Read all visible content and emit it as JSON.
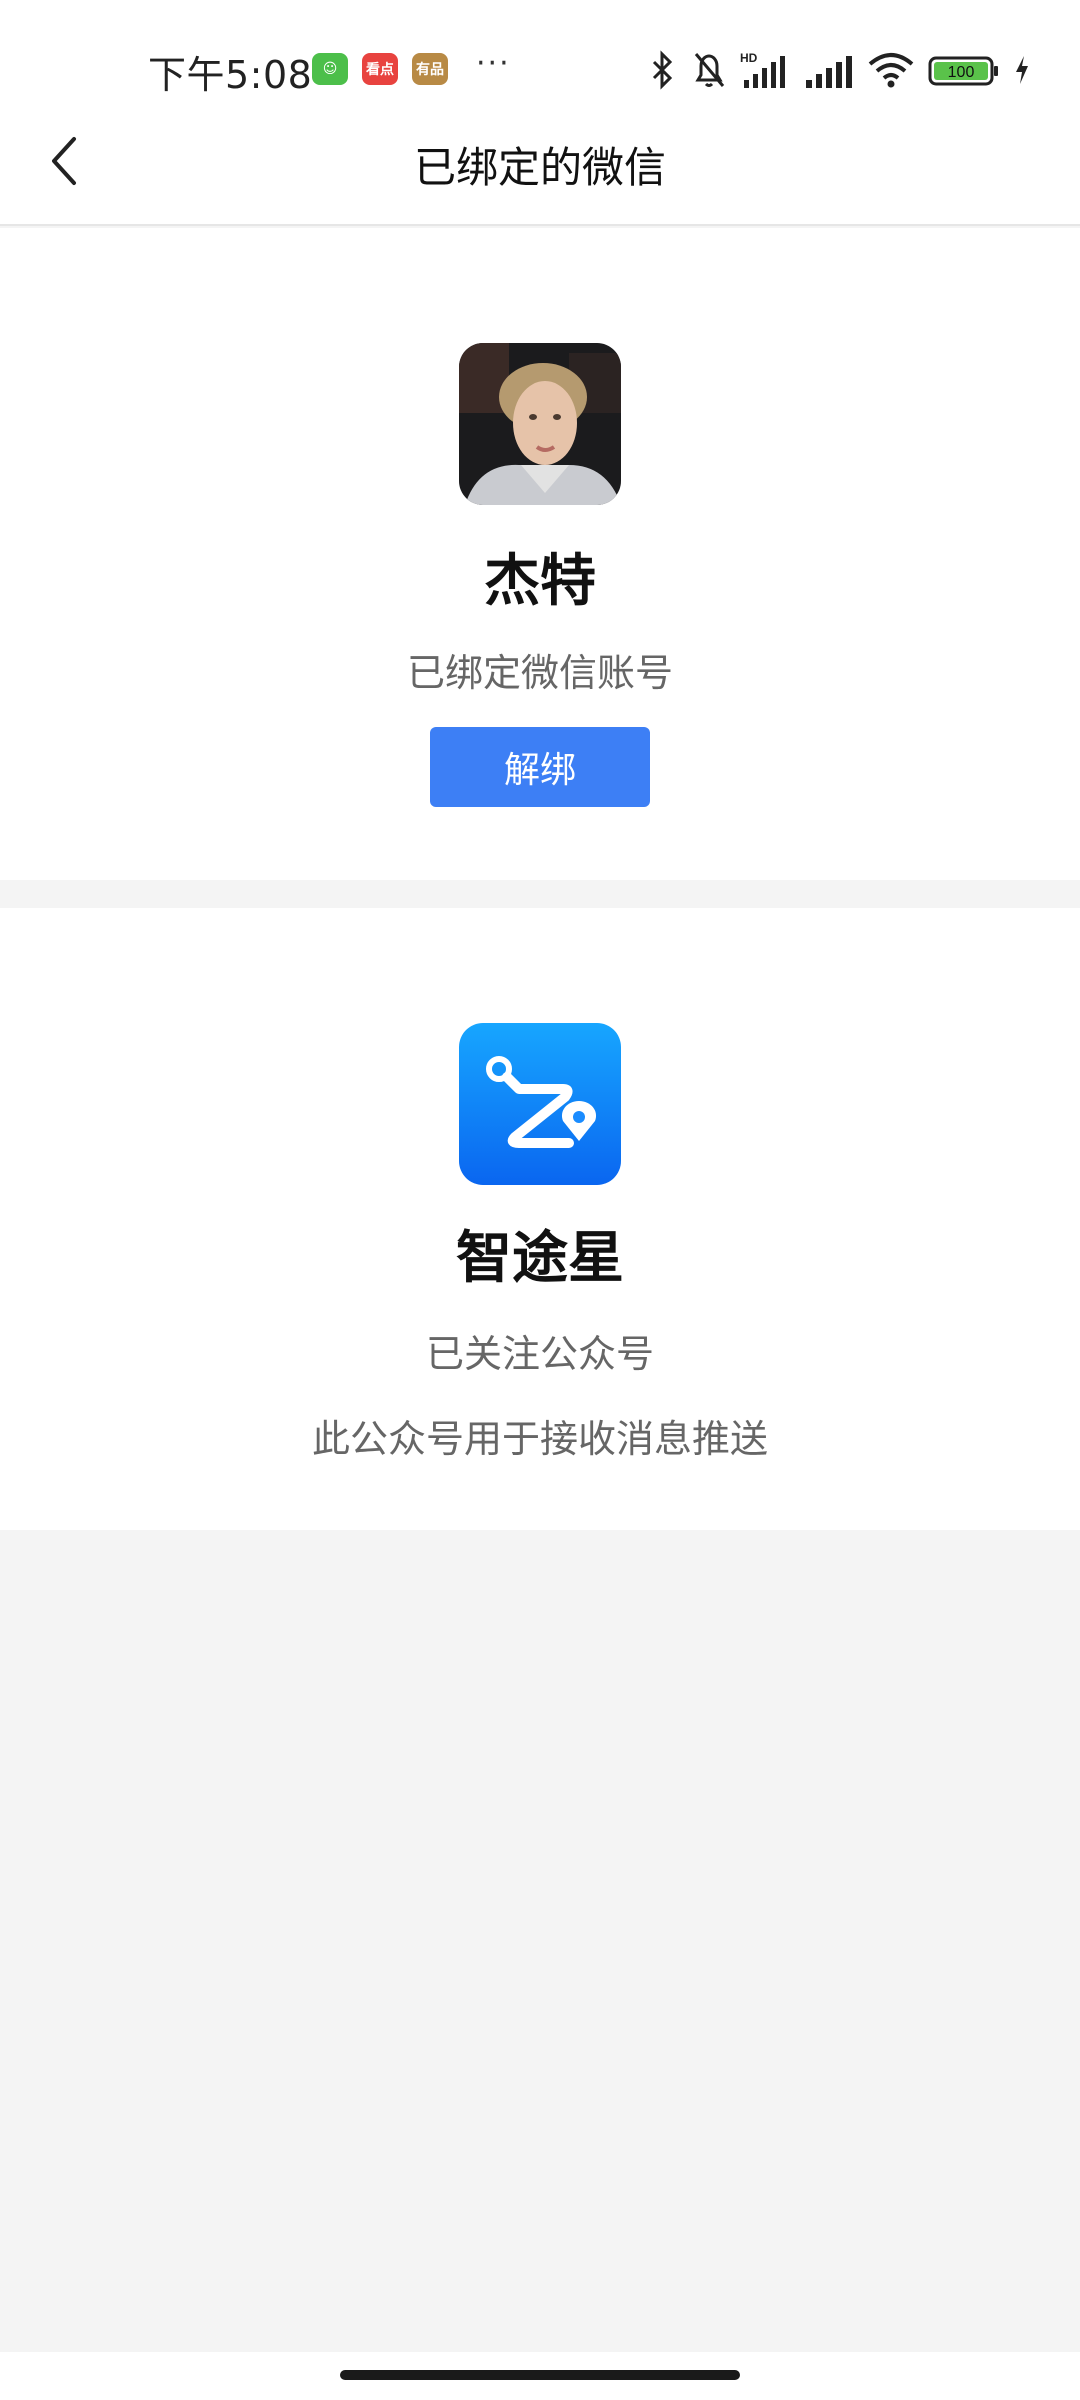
{
  "status_bar": {
    "time": "下午5:08",
    "notification_icons": [
      {
        "name": "cat-app-icon",
        "color": "#4cbf4a"
      },
      {
        "name": "news-app-icon",
        "color": "#e8433f",
        "label": "看点"
      },
      {
        "name": "youpin-app-icon",
        "color": "#b88a45",
        "label": "有品"
      }
    ],
    "more": "···",
    "battery": "100",
    "hd_label": "HD"
  },
  "navbar": {
    "back_icon": "chevron-left-icon",
    "title": "已绑定的微信"
  },
  "wechat_account": {
    "name": "杰特",
    "status": "已绑定微信账号",
    "unbind_label": "解绑"
  },
  "official_account": {
    "name": "智途星",
    "status": "已关注公众号",
    "description": "此公众号用于接收消息推送",
    "logo_color": "#1a8cff"
  }
}
